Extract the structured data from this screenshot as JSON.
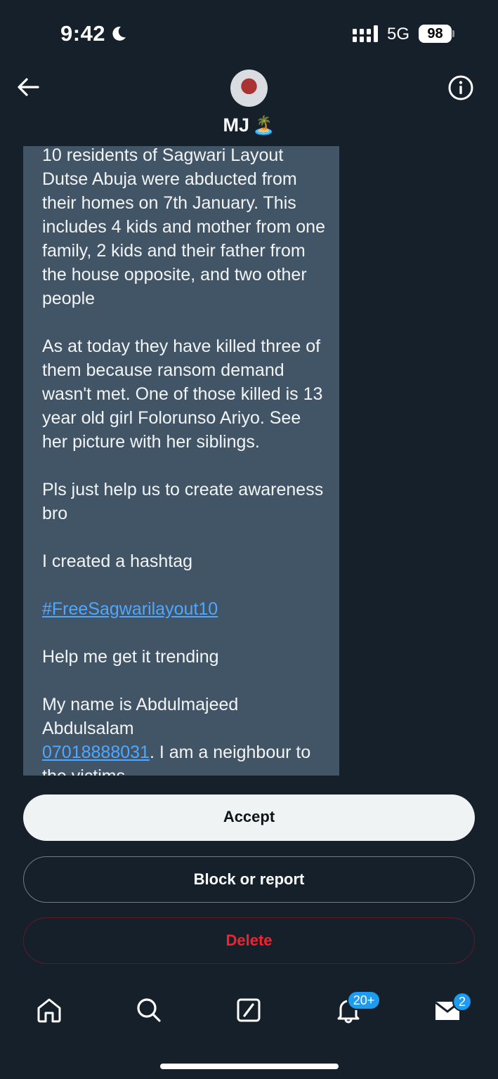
{
  "status_bar": {
    "time": "9:42",
    "network": "5G",
    "battery": "98"
  },
  "header": {
    "name": "MJ",
    "name_emoji": "🏝️",
    "back_icon": "back-arrow-icon",
    "info_icon": "info-icon"
  },
  "message": {
    "p1": "10 residents of Sagwari Layout Dutse Abuja were abducted from their homes on 7th January. This includes 4 kids and mother from one family, 2 kids and their father from the house opposite, and two other people",
    "p2": "As at today they have killed three of them because ransom demand wasn't met. One of those killed is 13 year old girl Folorunso Ariyo. See her picture with her siblings.",
    "p3": "Pls just help us to create awareness bro",
    "p4": "I created a hashtag",
    "hashtag": "#FreeSagwarilayout10",
    "p5": "Help me get it trending",
    "p6_line1": "My name is Abdulmajeed Abdulsalam",
    "phone": "07018888031",
    "p6_rest": ". I am a neighbour to the victims"
  },
  "actions": {
    "accept": "Accept",
    "block_or_report": "Block or report",
    "delete": "Delete"
  },
  "nav": {
    "notifications_badge": "20+",
    "messages_badge": "2"
  },
  "colors": {
    "background": "#15202b",
    "bubble": "#425566",
    "link": "#4fa8ff",
    "accent": "#1d9bf0",
    "delete": "#f4212e"
  }
}
